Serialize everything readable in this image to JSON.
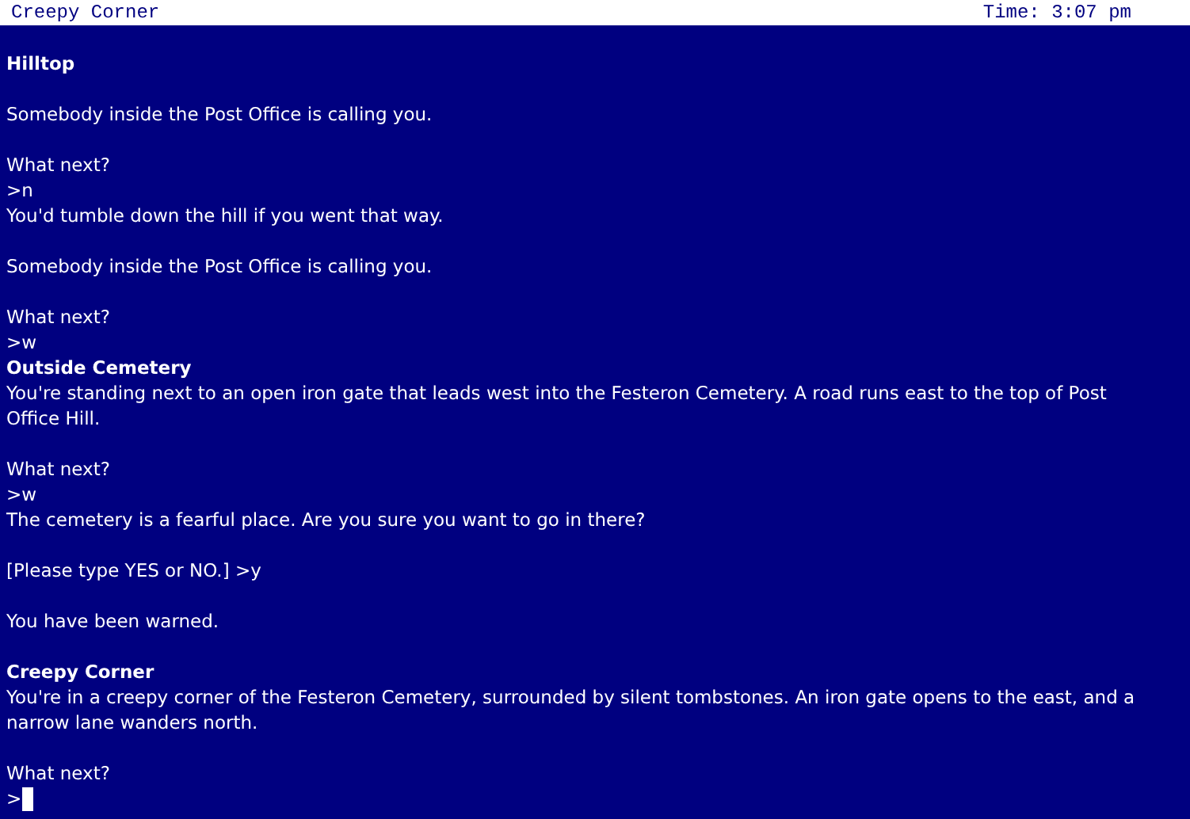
{
  "status_bar": {
    "location": "Creepy Corner",
    "time": "Time: 3:07 pm"
  },
  "transcript": [
    {
      "kind": "blank"
    },
    {
      "kind": "heading",
      "text": "Hilltop"
    },
    {
      "kind": "blank"
    },
    {
      "kind": "text",
      "text": "Somebody inside the Post Office is calling you."
    },
    {
      "kind": "blank"
    },
    {
      "kind": "text",
      "text": "What next?"
    },
    {
      "kind": "input",
      "text": ">n"
    },
    {
      "kind": "text",
      "text": "You'd tumble down the hill if you went that way."
    },
    {
      "kind": "blank"
    },
    {
      "kind": "text",
      "text": "Somebody inside the Post Office is calling you."
    },
    {
      "kind": "blank"
    },
    {
      "kind": "text",
      "text": "What next?"
    },
    {
      "kind": "input",
      "text": ">w"
    },
    {
      "kind": "heading",
      "text": "Outside Cemetery"
    },
    {
      "kind": "text",
      "text": "You're standing next to an open iron gate that leads west into the Festeron Cemetery. A road runs east to the top of Post Office Hill."
    },
    {
      "kind": "blank"
    },
    {
      "kind": "text",
      "text": "What next?"
    },
    {
      "kind": "input",
      "text": ">w"
    },
    {
      "kind": "text",
      "text": "The cemetery is a fearful place. Are you sure you want to go in there?"
    },
    {
      "kind": "blank"
    },
    {
      "kind": "text",
      "text": "[Please type YES or NO.] >y"
    },
    {
      "kind": "blank"
    },
    {
      "kind": "text",
      "text": "You have been warned."
    },
    {
      "kind": "blank"
    },
    {
      "kind": "heading",
      "text": "Creepy Corner"
    },
    {
      "kind": "text",
      "text": "You're in a creepy corner of the Festeron Cemetery, surrounded by silent tombstones. An iron gate opens to the east, and a narrow lane wanders north."
    },
    {
      "kind": "blank"
    },
    {
      "kind": "text",
      "text": "What next?"
    }
  ],
  "command_line": {
    "prompt": ">"
  }
}
